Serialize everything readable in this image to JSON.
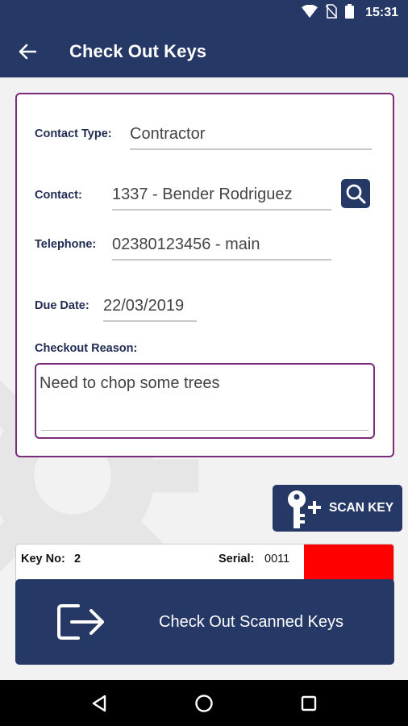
{
  "status_bar": {
    "time": "15:31",
    "icons": [
      "wifi-icon",
      "no-sim-icon",
      "battery-icon"
    ]
  },
  "app_bar": {
    "title": "Check Out Keys",
    "back_icon": "arrow-left-icon"
  },
  "form": {
    "contact_type": {
      "label": "Contact Type:",
      "value": "Contractor"
    },
    "contact": {
      "label": "Contact:",
      "value": "1337 - Bender Rodriguez",
      "search_icon": "search-icon"
    },
    "telephone": {
      "label": "Telephone:",
      "value": "02380123456 - main"
    },
    "due_date": {
      "label": "Due Date:",
      "value": "22/03/2019"
    },
    "checkout_reason": {
      "label": "Checkout Reason:",
      "value": "Need to chop some trees"
    }
  },
  "scan_key_button": {
    "label": "SCAN KEY",
    "icon": "key-add-icon"
  },
  "key_list": [
    {
      "key_no_label": "Key No:",
      "key_no": "2",
      "serial_label": "Serial:",
      "serial": "0011",
      "status_color": "#ff0000"
    }
  ],
  "checkout_button": {
    "label": "Check Out Scanned Keys",
    "icon": "exit-icon"
  },
  "nav_bar": {
    "buttons": [
      "back-triangle-icon",
      "home-circle-icon",
      "recents-square-icon"
    ]
  },
  "colors": {
    "primary": "#263866",
    "accent": "#7b2a7a",
    "status_red": "#ff0000"
  }
}
